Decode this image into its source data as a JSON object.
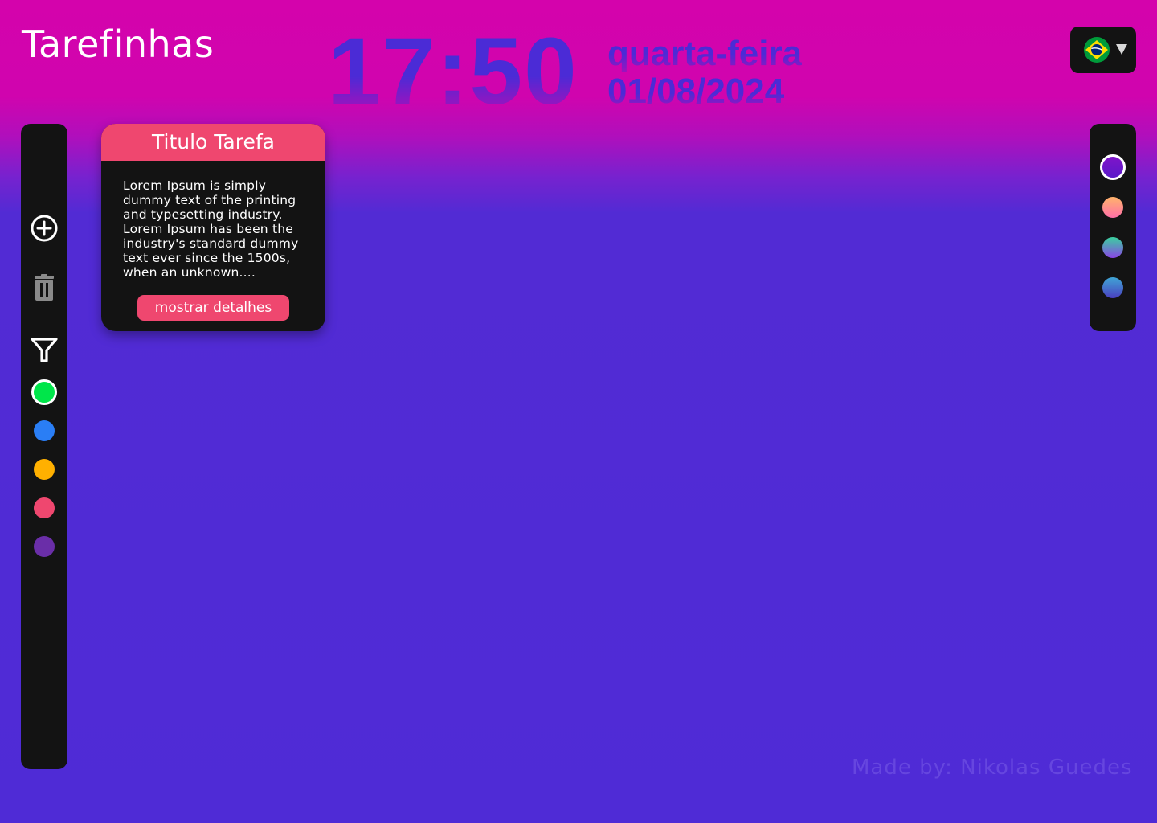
{
  "header": {
    "app_title": "Tarefinhas",
    "clock_time": "17:50",
    "clock_day": "quarta-feira",
    "clock_date": "01/08/2024",
    "language": {
      "selected_flag": "brazil-flag-icon",
      "caret_icon": "caret-down-icon"
    }
  },
  "sidebar_left": {
    "actions": [
      {
        "name": "add-task",
        "icon": "plus-circle-icon"
      },
      {
        "name": "delete",
        "icon": "trash-icon"
      },
      {
        "name": "filter",
        "icon": "filter-icon"
      }
    ],
    "filter_colors": [
      {
        "name": "green",
        "color": "#00e64a",
        "selected": true
      },
      {
        "name": "blue",
        "color": "#2a7ef5",
        "selected": false
      },
      {
        "name": "yellow",
        "color": "#ffb000",
        "selected": false
      },
      {
        "name": "red",
        "color": "#ef476f",
        "selected": false
      },
      {
        "name": "purple",
        "color": "#6a2ea8",
        "selected": false
      }
    ]
  },
  "sidebar_right": {
    "themes": [
      {
        "name": "purple",
        "colors": [
          "#7f14c9",
          "#5a19c9"
        ],
        "selected": true
      },
      {
        "name": "peach-pink",
        "colors": [
          "#ffb36b",
          "#ff6fa8"
        ],
        "selected": false
      },
      {
        "name": "teal-violet",
        "colors": [
          "#3ad1a0",
          "#8a45e6"
        ],
        "selected": false
      },
      {
        "name": "blue-indigo",
        "colors": [
          "#3fa6d6",
          "#4a3fc0"
        ],
        "selected": false
      }
    ]
  },
  "task_card": {
    "title": "Titulo Tarefa",
    "description": "Lorem Ipsum is simply dummy text of the printing and typesetting industry. Lorem Ipsum has been the industry's standard dummy text ever since the 1500s, when an unknown....",
    "button_label": "mostrar detalhes",
    "header_color": "#ef476f"
  },
  "footer": {
    "credits": "Made by: Nikolas Guedes"
  }
}
